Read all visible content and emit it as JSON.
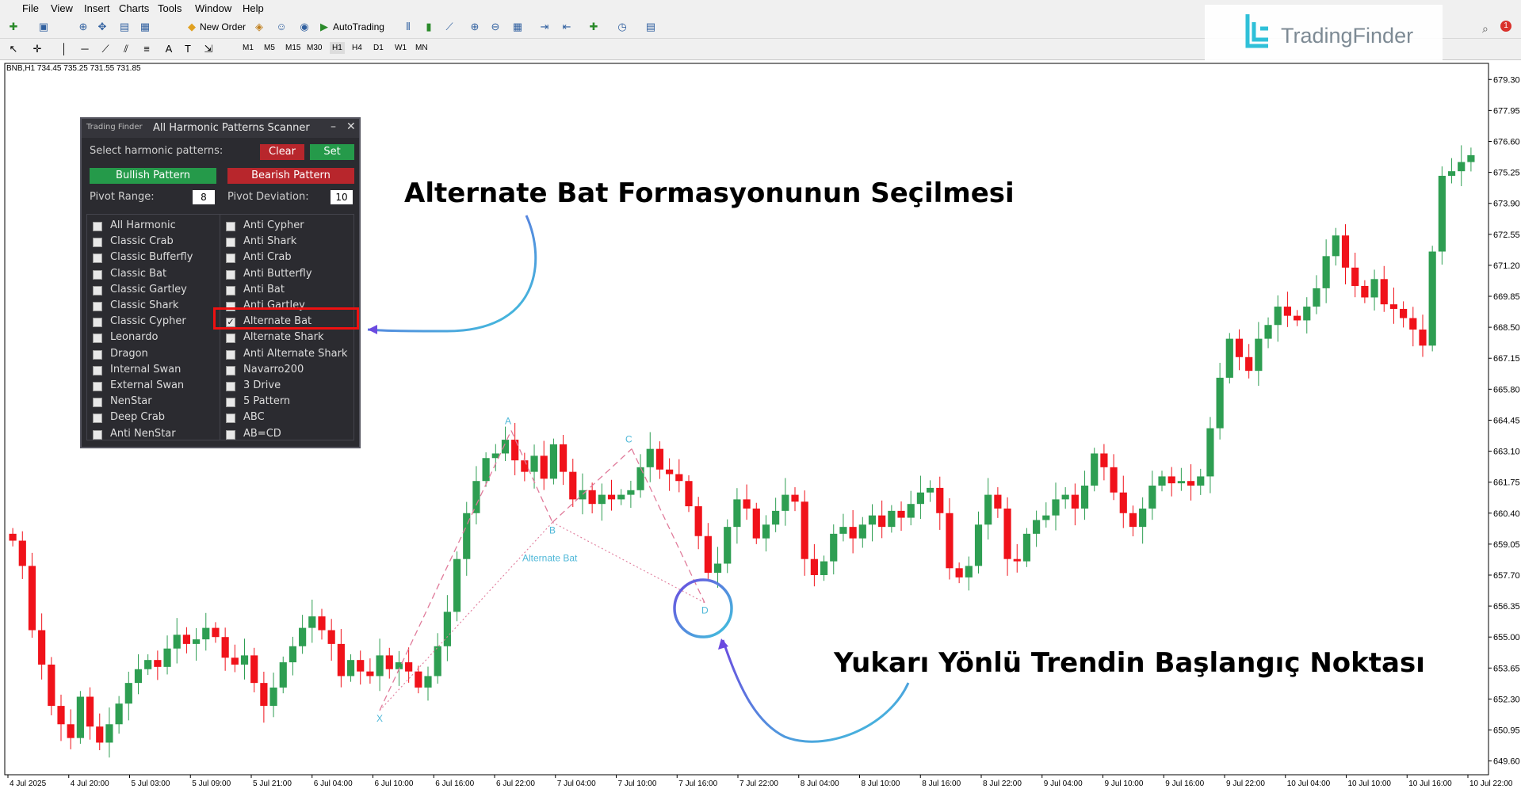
{
  "menu": [
    "File",
    "View",
    "Insert",
    "Charts",
    "Tools",
    "Window",
    "Help"
  ],
  "toolbar": {
    "new_order": "New Order",
    "autotrading": "AutoTrading",
    "timeframes": [
      "M1",
      "M5",
      "M15",
      "M30",
      "H1",
      "H4",
      "D1",
      "W1",
      "MN"
    ],
    "active_timeframe": "H1"
  },
  "symbol_info": "BNB,H1  734.45 735.25 731.55 731.85",
  "logo_text": "TradingFinder",
  "panel": {
    "brand": "Trading Finder",
    "title": "All Harmonic Patterns Scanner",
    "select_label": "Select harmonic patterns:",
    "clear": "Clear",
    "set": "Set",
    "bullish": "Bullish Pattern",
    "bearish": "Bearish Pattern",
    "pivot_range_label": "Pivot Range:",
    "pivot_range": "8",
    "pivot_dev_label": "Pivot Deviation:",
    "pivot_dev": "10",
    "left_list": [
      "All Harmonic",
      "Classic Crab",
      "Classic Bufferfly",
      "Classic Bat",
      "Classic Gartley",
      "Classic Shark",
      "Classic Cypher",
      "Leonardo",
      "Dragon",
      "Internal Swan",
      "External Swan",
      "NenStar",
      "Deep Crab",
      "Anti NenStar"
    ],
    "right_list": [
      "Anti Cypher",
      "Anti Shark",
      "Anti Crab",
      "Anti Butterfly",
      "Anti Bat",
      "Anti Gartley",
      "Alternate Bat",
      "Alternate Shark",
      "Anti Alternate Shark",
      "Navarro200",
      "3 Drive",
      "5 Pattern",
      "ABC",
      "AB=CD"
    ],
    "checked": "Alternate Bat"
  },
  "annotations": {
    "top": "Alternate Bat Formasyonunun Seçilmesi",
    "bottom": "Yukarı Yönlü Trendin Başlangıç Noktası",
    "pattern_label": "Alternate Bat",
    "points": [
      "X",
      "A",
      "B",
      "C",
      "D"
    ]
  },
  "colors": {
    "bull": "#2e9e52",
    "bear": "#f0121a",
    "pattern": "#e07a9a",
    "point": "#4fb8d8",
    "highlight": "#ee1111"
  },
  "chart_data": {
    "type": "candlestick",
    "price_ticks": [
      "679.30",
      "677.95",
      "676.60",
      "675.25",
      "673.90",
      "672.55",
      "671.20",
      "669.85",
      "668.50",
      "667.15",
      "665.80",
      "664.45",
      "663.10",
      "661.75",
      "660.40",
      "659.05",
      "657.70",
      "656.35",
      "655.00",
      "653.65",
      "652.30",
      "650.95",
      "649.60"
    ],
    "time_ticks": [
      "4 Jul 2025",
      "4 Jul 20:00",
      "5 Jul 03:00",
      "5 Jul 09:00",
      "5 Jul 21:00",
      "6 Jul 04:00",
      "6 Jul 10:00",
      "6 Jul 16:00",
      "6 Jul 22:00",
      "7 Jul 04:00",
      "7 Jul 10:00",
      "7 Jul 16:00",
      "7 Jul 22:00",
      "8 Jul 04:00",
      "8 Jul 10:00",
      "8 Jul 16:00",
      "8 Jul 22:00",
      "9 Jul 04:00",
      "9 Jul 10:00",
      "9 Jul 16:00",
      "9 Jul 22:00",
      "10 Jul 04:00",
      "10 Jul 10:00",
      "10 Jul 16:00",
      "10 Jul 22:00"
    ],
    "ylim": [
      649.0,
      680.0
    ],
    "closes": [
      659.2,
      658.1,
      655.3,
      653.8,
      652.0,
      651.2,
      650.6,
      652.4,
      651.1,
      650.4,
      651.2,
      652.1,
      653.0,
      653.6,
      654.0,
      653.7,
      654.5,
      655.1,
      654.7,
      654.9,
      655.4,
      655.0,
      654.1,
      653.8,
      654.2,
      653.0,
      652.0,
      652.8,
      653.9,
      654.6,
      655.4,
      655.9,
      655.3,
      654.7,
      653.3,
      654.0,
      653.5,
      653.3,
      654.2,
      653.6,
      653.9,
      653.5,
      652.8,
      653.3,
      654.6,
      656.1,
      658.4,
      660.4,
      661.8,
      662.8,
      663.0,
      663.6,
      662.7,
      662.2,
      662.9,
      661.9,
      663.4,
      662.2,
      661.0,
      661.4,
      660.8,
      661.2,
      661.0,
      661.2,
      661.4,
      662.4,
      663.2,
      662.3,
      662.1,
      661.8,
      660.7,
      659.4,
      657.8,
      658.2,
      659.8,
      661.0,
      660.6,
      659.3,
      659.9,
      660.5,
      661.2,
      660.9,
      658.4,
      657.7,
      658.3,
      659.5,
      659.8,
      659.3,
      659.9,
      660.3,
      659.8,
      660.5,
      660.2,
      660.8,
      661.3,
      661.5,
      660.4,
      658.0,
      657.6,
      658.1,
      659.9,
      661.2,
      660.6,
      658.4,
      658.3,
      659.5,
      660.1,
      660.3,
      661.0,
      661.2,
      660.6,
      661.6,
      663.0,
      662.4,
      661.3,
      660.4,
      659.8,
      660.6,
      661.6,
      662.0,
      661.7,
      661.8,
      661.6,
      662.0,
      664.1,
      666.3,
      668.0,
      667.2,
      666.6,
      668.0,
      668.6,
      669.4,
      669.0,
      668.8,
      669.4,
      670.2,
      671.6,
      672.5,
      671.1,
      670.3,
      669.8,
      670.6,
      669.5,
      669.3,
      668.9,
      668.4,
      667.7,
      671.8,
      675.1,
      675.3,
      675.7,
      676.0
    ]
  }
}
